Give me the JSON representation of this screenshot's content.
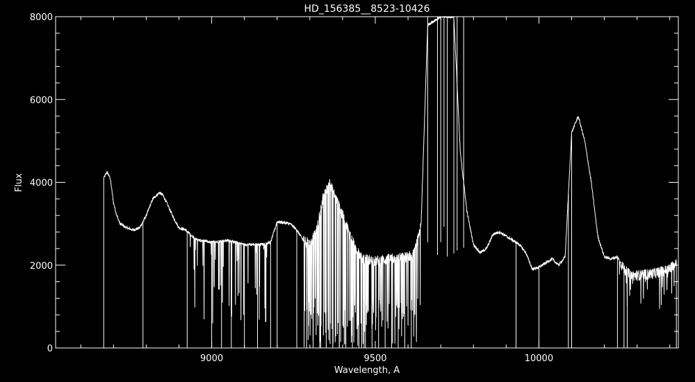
{
  "chart_data": {
    "type": "line",
    "title": "HD_156385__8523-10426",
    "xlabel": "Wavelength, A",
    "ylabel": "Flux",
    "xlim": [
      8523,
      10426
    ],
    "ylim": [
      0,
      8000
    ],
    "x_ticks": [
      9000,
      9500,
      10000
    ],
    "y_ticks": [
      0,
      2000,
      4000,
      6000,
      8000
    ],
    "x_minor_step": 100,
    "y_minor_step": 400,
    "grid": false,
    "colors": {
      "background": "#000000",
      "foreground": "#ffffff"
    },
    "series": [
      {
        "x": [
          8670,
          8680,
          8690,
          8700,
          8710,
          8720,
          8740,
          8760,
          8780,
          8800,
          8820,
          8840,
          8850,
          8860,
          8880,
          8900,
          8920,
          8940,
          8960,
          8980,
          9000,
          9050,
          9100,
          9150,
          9180,
          9200,
          9240,
          9260,
          9280,
          9300,
          9320,
          9340,
          9360,
          9380,
          9400,
          9420,
          9440,
          9460,
          9500,
          9550,
          9600,
          9620,
          9640,
          9660,
          9700,
          9740,
          9760,
          9780,
          9800,
          9820,
          9840,
          9860,
          9880,
          9900,
          9920,
          9940,
          9960,
          9980,
          10000,
          10020,
          10040,
          10060,
          10080,
          10100,
          10120,
          10140,
          10160,
          10180,
          10200,
          10220,
          10240,
          10260,
          10280,
          10300,
          10350,
          10400,
          10420
        ],
        "y": [
          4100,
          4250,
          4100,
          3500,
          3200,
          3000,
          2900,
          2850,
          2900,
          3200,
          3600,
          3750,
          3700,
          3550,
          3200,
          2900,
          2850,
          2700,
          2600,
          2580,
          2550,
          2600,
          2500,
          2500,
          2550,
          3050,
          3000,
          2850,
          2600,
          2500,
          2800,
          3600,
          4000,
          3600,
          3200,
          2800,
          2400,
          2150,
          2100,
          2150,
          2200,
          2300,
          3000,
          7800,
          8000,
          8000,
          4700,
          3300,
          2500,
          2300,
          2400,
          2750,
          2800,
          2700,
          2600,
          2500,
          2300,
          1900,
          1950,
          2050,
          2150,
          2000,
          2200,
          5200,
          5600,
          5000,
          4000,
          2700,
          2200,
          2150,
          2200,
          1900,
          1750,
          1750,
          1800,
          1900,
          2100
        ]
      }
    ],
    "absorption_lines": [
      8670,
      8790,
      8925,
      9000,
      9030,
      9060,
      9100,
      9140,
      9180,
      9200,
      9260,
      9290,
      9310,
      9330,
      9350,
      9370,
      9390,
      9410,
      9430,
      9450,
      9470,
      9490,
      9510,
      9530,
      9550,
      9570,
      9590,
      9610,
      9660,
      9690,
      9700,
      9710,
      9720,
      9740,
      9750,
      9770,
      9930,
      10000,
      10090,
      10100,
      10240,
      10260,
      10270,
      10420
    ]
  }
}
